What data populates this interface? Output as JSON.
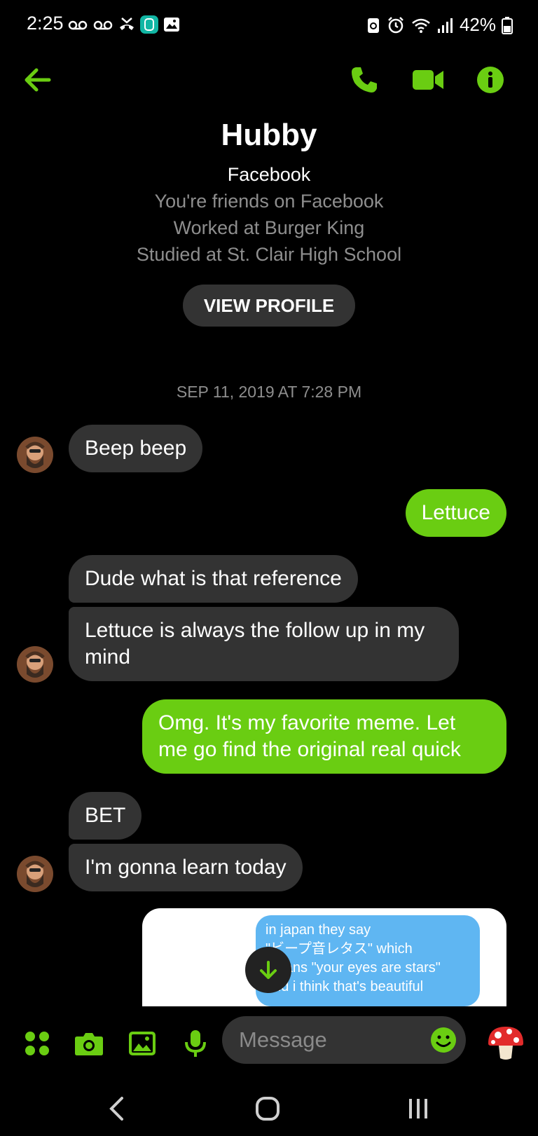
{
  "status_bar": {
    "time": "2:25",
    "battery": "42%"
  },
  "header": {
    "name": "Hubby",
    "platform": "Facebook",
    "info_lines": [
      "You're friends on Facebook",
      "Worked at Burger King",
      "Studied at St. Clair High School"
    ],
    "view_profile": "VIEW PROFILE"
  },
  "timestamp": "SEP 11, 2019 AT 7:28 PM",
  "messages": [
    {
      "from": "them",
      "text": "Beep beep"
    },
    {
      "from": "me",
      "text": "Lettuce"
    },
    {
      "from": "them",
      "text": "Dude what is that reference"
    },
    {
      "from": "them",
      "text": "Lettuce is always the follow up in my mind"
    },
    {
      "from": "me",
      "text": "Omg. It's my favorite meme. Let me go find the original real quick"
    },
    {
      "from": "them",
      "text": "BET"
    },
    {
      "from": "them",
      "text": "I'm gonna learn today"
    }
  ],
  "image_message": {
    "lines": [
      "in japan they say",
      "\"ビープ音レタス\" which",
      "means \"your eyes are stars\"",
      "and i think that's beautiful"
    ]
  },
  "composer": {
    "placeholder": "Message"
  },
  "colors": {
    "accent": "#6acd12",
    "incoming": "#333333",
    "background": "#000000"
  }
}
